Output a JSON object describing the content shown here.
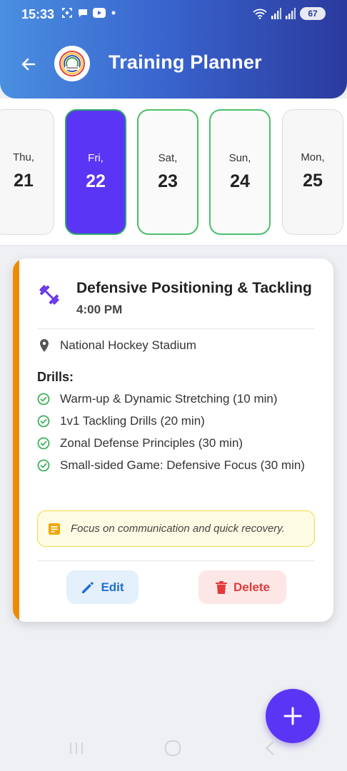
{
  "status_bar": {
    "time": "15:33",
    "battery": "67"
  },
  "header": {
    "title": "Training Planner",
    "back_icon": "arrow-left-icon",
    "logo": "hockey-logo"
  },
  "dates": [
    {
      "dow": "Thu,",
      "day": "21",
      "state": "default"
    },
    {
      "dow": "Fri,",
      "day": "22",
      "state": "selected"
    },
    {
      "dow": "Sat,",
      "day": "23",
      "state": "has-event"
    },
    {
      "dow": "Sun,",
      "day": "24",
      "state": "has-event"
    },
    {
      "dow": "Mon,",
      "day": "25",
      "state": "default"
    }
  ],
  "session": {
    "title": "Defensive Positioning & Tackling",
    "time": "4:00 PM",
    "icon": "dumbbell-icon",
    "location": "National Hockey Stadium",
    "drills_heading": "Drills:",
    "drills": [
      "Warm-up & Dynamic Stretching (10 min)",
      "1v1 Tackling Drills (20 min)",
      "Zonal Defense Principles (30 min)",
      "Small-sided Game: Defensive Focus (30 min)"
    ],
    "note": "Focus on communication and quick recovery.",
    "edit_label": "Edit",
    "delete_label": "Delete"
  },
  "colors": {
    "accent": "#5b35f5",
    "card_accent": "#f08a00",
    "event_border": "#4cc06a",
    "edit": "#1f6fd0",
    "delete": "#e23b3b"
  },
  "fab": {
    "icon": "plus-icon"
  }
}
